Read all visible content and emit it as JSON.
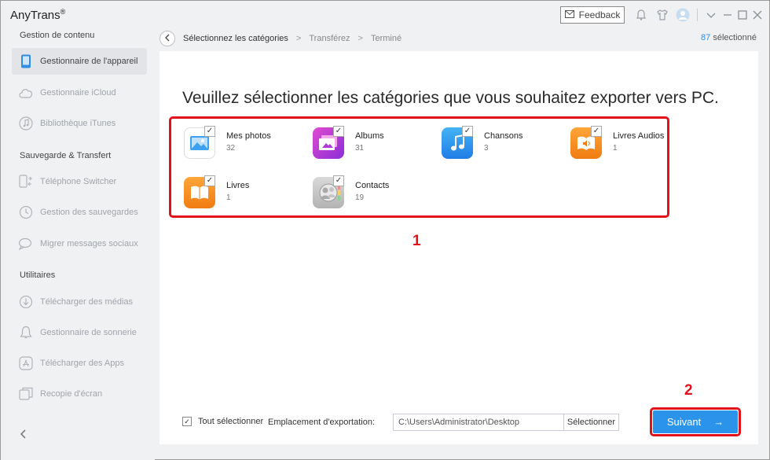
{
  "app": {
    "title": "AnyTrans",
    "mark": "®"
  },
  "titlebar": {
    "feedback_label": "Feedback"
  },
  "sidebar": {
    "sections": [
      {
        "title": "Gestion de contenu"
      },
      {
        "title": "Sauvegarde & Transfert"
      },
      {
        "title": "Utilitaires"
      }
    ],
    "items": [
      {
        "label": "Gestionnaire de l'appareil",
        "icon": "phone-icon",
        "active": true
      },
      {
        "label": "Gestionnaire iCloud",
        "icon": "cloud-icon"
      },
      {
        "label": "Bibliothèque iTunes",
        "icon": "music-note-icon"
      },
      {
        "label": "Téléphone Switcher",
        "icon": "phone-switch-icon"
      },
      {
        "label": "Gestion des sauvegardes",
        "icon": "history-icon"
      },
      {
        "label": "Migrer messages sociaux",
        "icon": "chat-icon"
      },
      {
        "label": "Télécharger des médias",
        "icon": "download-icon"
      },
      {
        "label": "Gestionnaire de sonnerie",
        "icon": "bell-icon"
      },
      {
        "label": "Télécharger des Apps",
        "icon": "app-store-icon"
      },
      {
        "label": "Recopie d'écran",
        "icon": "screen-mirror-icon"
      }
    ]
  },
  "breadcrumb": {
    "steps": [
      "Sélectionnez les catégories",
      "Transférez",
      "Terminé"
    ],
    "separator": ">"
  },
  "selection": {
    "count": "87",
    "suffix": "sélectionné"
  },
  "main": {
    "headline": "Veuillez sélectionner les catégories que vous souhaitez exporter vers PC.",
    "categories": [
      {
        "name": "Mes photos",
        "count": "32",
        "icon": "photos-icon",
        "color": "#3ea0f0"
      },
      {
        "name": "Albums",
        "count": "31",
        "icon": "albums-icon",
        "color": "#b13bd6"
      },
      {
        "name": "Chansons",
        "count": "3",
        "icon": "music-icon",
        "color": "#2a8df0"
      },
      {
        "name": "Livres Audios",
        "count": "1",
        "icon": "audiobook-icon",
        "color": "#f08c1c"
      },
      {
        "name": "Livres",
        "count": "1",
        "icon": "books-icon",
        "color": "#f0881a"
      },
      {
        "name": "Contacts",
        "count": "19",
        "icon": "contacts-icon",
        "color": "#bdbdbd"
      }
    ],
    "markers": [
      "1",
      "2"
    ]
  },
  "footer": {
    "select_all_label": "Tout sélectionner",
    "export_label": "Emplacement d'exportation:",
    "export_path": "C:\\Users\\Administrator\\Desktop",
    "choose_label": "Sélectionner",
    "next_label": "Suivant",
    "next_arrow": "→"
  },
  "colors": {
    "accent": "#2b94ea",
    "highlight": "#e2121b"
  }
}
